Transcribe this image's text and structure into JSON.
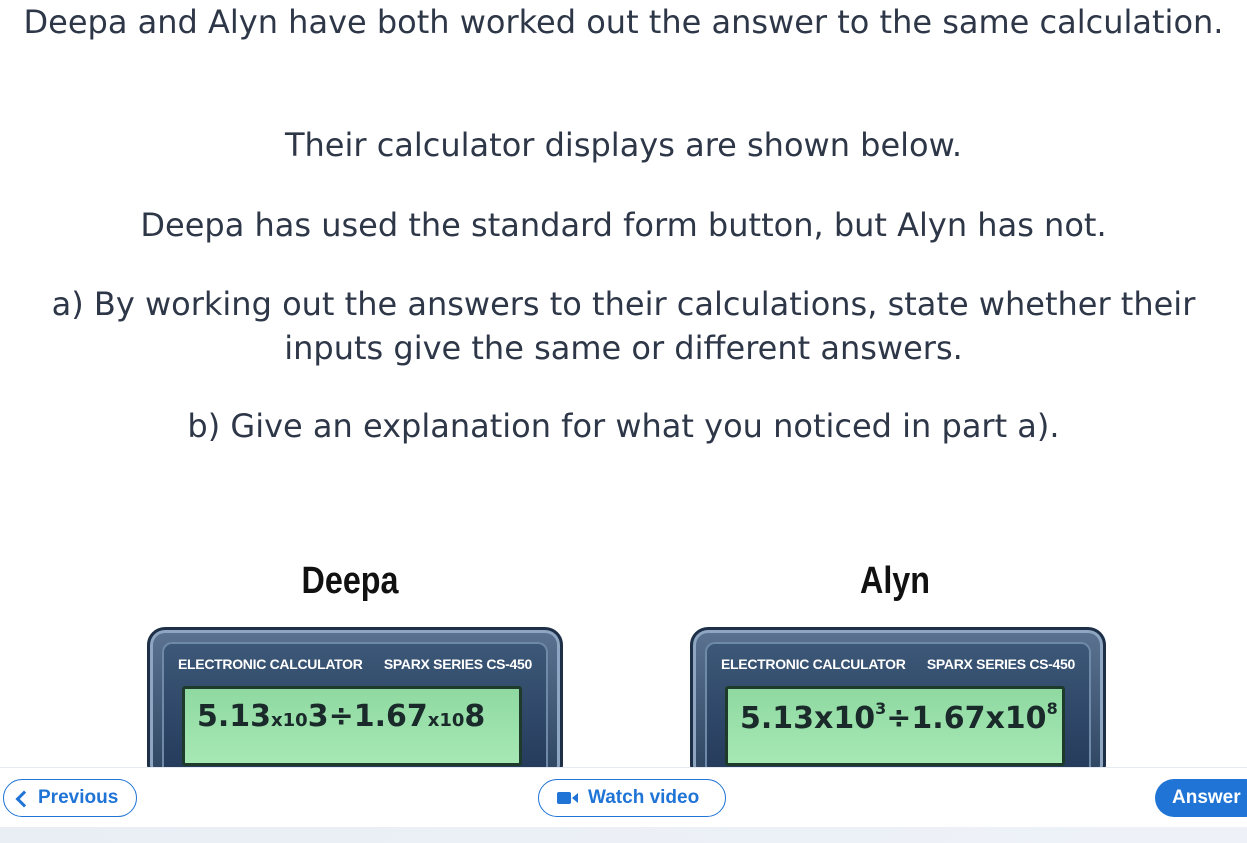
{
  "question": {
    "line1": "Deepa and Alyn have both worked out the answer to the same calculation.",
    "line2": "Their calculator displays are shown below.",
    "line3": "Deepa has used the standard form button, but Alyn has not.",
    "line4": "a) By working out the answers to their calculations, state whether their inputs give the same or different answers.",
    "line5": "b) Give an explanation for what you noticed in part a)."
  },
  "calculators": [
    {
      "name": "Deepa",
      "brand_left": "ELECTRONIC CALCULATOR",
      "brand_right": "SPARX SERIES CS-450",
      "display": {
        "a": "5.13",
        "x1": "x10",
        "e1": "3",
        "op": "÷",
        "b": "1.67",
        "x2": "x10",
        "e2": "8"
      }
    },
    {
      "name": "Alyn",
      "brand_left": "ELECTRONIC CALCULATOR",
      "brand_right": "SPARX SERIES CS-450",
      "display": {
        "a": "5.13",
        "x1": "x10",
        "e1": "3",
        "op": "÷",
        "b": "1.67",
        "x2": "x10",
        "e2": "8"
      }
    }
  ],
  "footer": {
    "previous_label": "Previous",
    "video_label": "Watch video",
    "answer_label": "Answer"
  },
  "colors": {
    "accent": "#1f74d6",
    "screen": "#a7e8b5",
    "text": "#2e3748"
  },
  "icons": [
    "chevron-left-icon",
    "video-camera-icon"
  ]
}
